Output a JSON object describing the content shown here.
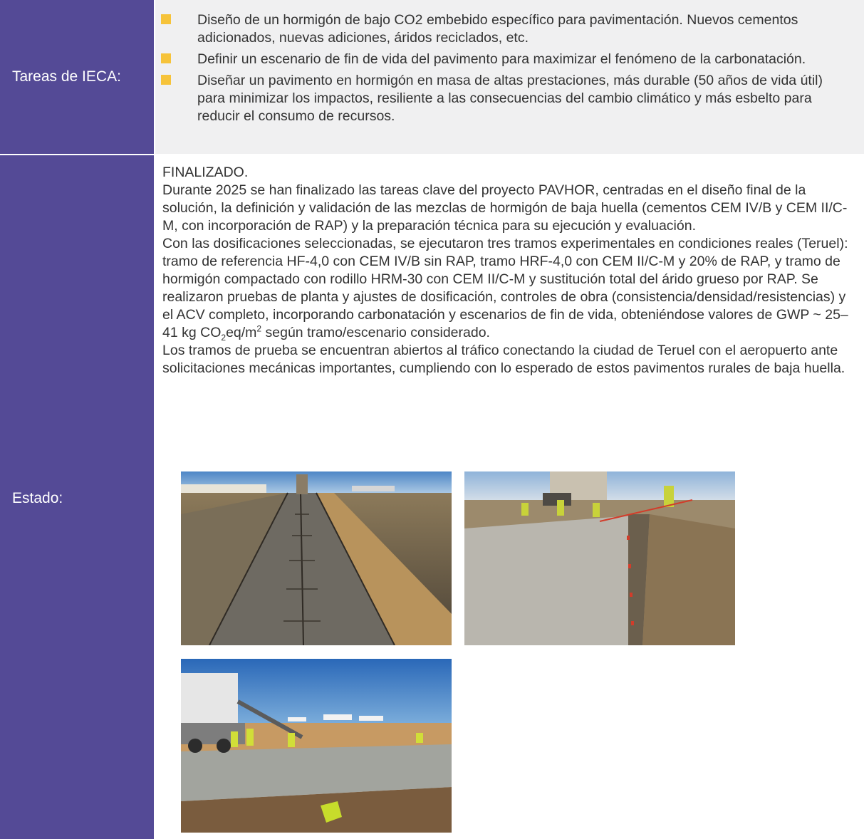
{
  "tareas": {
    "label": "Tareas de IECA:",
    "items": [
      "Diseño de un hormigón de bajo CO2 embebido específico para pavimentación. Nuevos cementos adicionados, nuevas adiciones, áridos reciclados, etc.",
      "Definir un escenario de fin de vida del pavimento para maximizar el fenómeno de la carbonatación.",
      "Diseñar un pavimento en hormigón en masa de altas prestaciones, más durable (50 años de vida útil) para minimizar los impactos, resiliente a las consecuencias del cambio climático y más esbelto para reducir el consumo de recursos."
    ]
  },
  "estado": {
    "label": "Estado:",
    "status": "FINALIZADO.",
    "p1": "Durante 2025 se han finalizado las tareas clave del proyecto PAVHOR, centradas en el diseño final de la solución, la definición y validación de las mezclas de hormigón de baja huella (cementos CEM IV/B y CEM II/C-M, con incorporación de RAP) y la preparación técnica para su ejecución y evaluación.",
    "p2_before": "Con las dosificaciones seleccionadas, se ejecutaron tres tramos experimentales en condiciones reales (Teruel): tramo de referencia HF-4,0 con CEM IV/B sin RAP, tramo HRF-4,0 con CEM II/C-M y 20% de RAP, y tramo de hormigón compactado con rodillo HRM-30 con CEM II/C-M y sustitución total del árido grueso por RAP. Se realizaron pruebas de planta y ajustes de dosificación, controles de obra (consistencia/densidad/resistencias) y el ACV completo, incorporando carbonatación y escenarios de fin de vida, obteniéndose valores de GWP ~ 25–41 kg CO",
    "p2_sub": "2",
    "p2_mid": "eq/m",
    "p2_sup": "2",
    "p2_after": " según tramo/escenario considerado.",
    "p3": "Los tramos de prueba se encuentran abiertos al tráfico conectando la ciudad de Teruel con el aeropuerto ante solicitaciones mecánicas importantes, cumpliendo con lo esperado de estos pavimentos rurales de baja huella."
  },
  "colors": {
    "label_bg": "#544a96",
    "bullet": "#f6c33a",
    "row_bg": "#f0f0f1"
  }
}
